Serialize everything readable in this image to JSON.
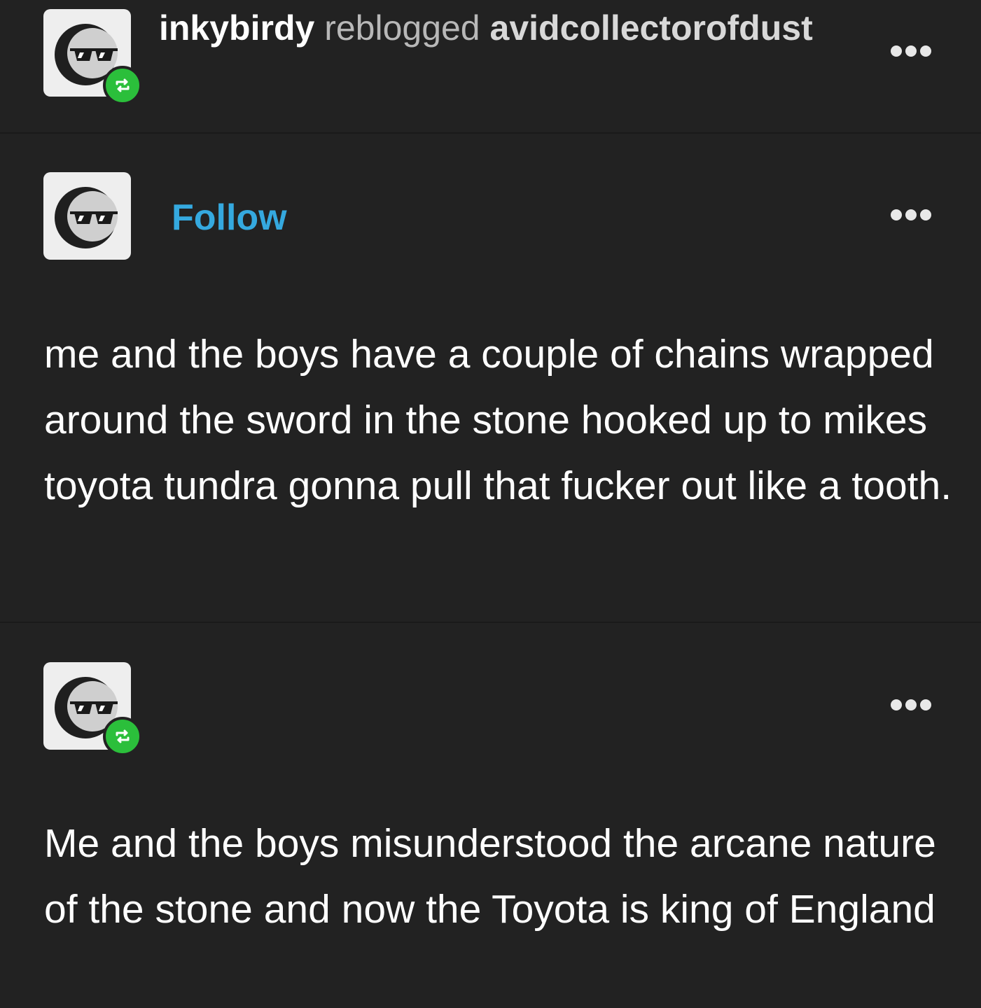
{
  "reblog_header": {
    "username": "inkybirdy",
    "action": "reblogged",
    "source": "avidcollectorofdust"
  },
  "original_post": {
    "follow_label": "Follow",
    "text": "me and the boys have a couple of chains wrapped around the sword in the stone hooked up to mikes toyota tundra gonna pull that fucker out like a tooth."
  },
  "reply_post": {
    "text": "Me and the boys misunderstood the arcane nature of the stone and now the Toyota is king of England"
  },
  "icons": {
    "avatar": "sunglasses-face-avatar",
    "reblog_badge": "reblog-icon",
    "more": "more-options-icon"
  },
  "colors": {
    "background": "#222222",
    "follow_link": "#35a9df",
    "reblog_badge": "#2bbf3b"
  }
}
